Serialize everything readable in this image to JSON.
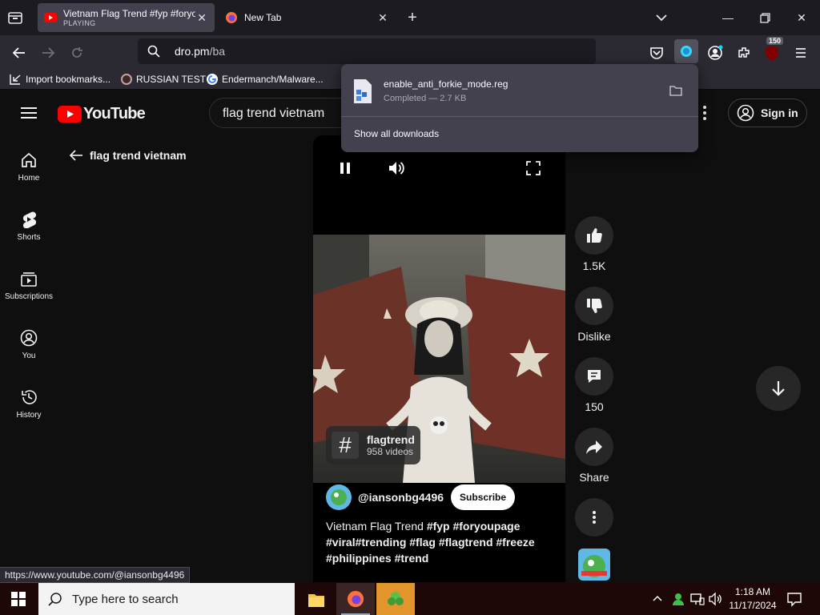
{
  "browser": {
    "tabs": [
      {
        "title": "Vietnam Flag Trend #fyp #foryo",
        "subtitle": "PLAYING",
        "active": true
      },
      {
        "title": "New Tab",
        "subtitle": "",
        "active": false
      }
    ],
    "url_host": "dro.pm",
    "url_path": "/ba",
    "extension_badge": "150",
    "bookmarks": [
      "Import bookmarks...",
      "RUSSIAN TEST",
      "Endermanch/Malware..."
    ],
    "status_link": "https://www.youtube.com/@iansonbg4496"
  },
  "downloads": {
    "filename": "enable_anti_forkie_mode.reg",
    "status": "Completed — 2.7 KB",
    "show_all": "Show all downloads"
  },
  "youtube": {
    "logo_text": "YouTube",
    "search_value": "flag trend vietnam",
    "sign_in": "Sign in",
    "back_label": "flag trend vietnam",
    "sidebar": [
      {
        "label": "Home",
        "icon": "home-icon"
      },
      {
        "label": "Shorts",
        "icon": "shorts-icon"
      },
      {
        "label": "Subscriptions",
        "icon": "subscriptions-icon"
      },
      {
        "label": "You",
        "icon": "you-icon"
      },
      {
        "label": "History",
        "icon": "history-icon"
      }
    ],
    "short": {
      "hashtag": "flagtrend",
      "hashtag_count": "958 videos",
      "channel": "@iansonbg4496",
      "subscribe": "Subscribe",
      "title_plain": "Vietnam Flag Trend ",
      "title_tags_line1": "#fyp #foryoupage",
      "title_line2": "#viral#trending #flag #flagtrend #freeze",
      "title_line3": "#philippines #trend"
    },
    "actions": {
      "likes": "1.5K",
      "dislike": "Dislike",
      "comments": "150",
      "share": "Share"
    }
  },
  "taskbar": {
    "search_placeholder": "Type here to search",
    "time": "1:18 AM",
    "date": "11/17/2024"
  },
  "colors": {
    "youtube_red": "#ff0000",
    "firefox_bg": "#1c1b22",
    "subscribe_bg": "#ffffff"
  }
}
